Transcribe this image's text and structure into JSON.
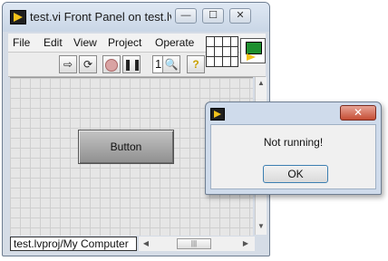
{
  "window": {
    "title": "test.vi Front Panel on test.lv...",
    "minimize_glyph": "—",
    "maximize_glyph": "☐",
    "close_glyph": "✕"
  },
  "menu": [
    "File",
    "Edit",
    "View",
    "Project",
    "Operate"
  ],
  "toolbar": {
    "run_icon": "run-arrow-icon",
    "run_continuous_icon": "run-continuously-icon",
    "abort_icon": "abort-icon",
    "pause_icon": "pause-icon",
    "font_size_text": "1",
    "search_icon": "search-icon",
    "help_icon": "help-icon"
  },
  "panel": {
    "button_label": "Button"
  },
  "status": {
    "target": "test.lvproj/My Computer"
  },
  "scrollbar": {
    "up": "▲",
    "down": "▼",
    "left": "◀",
    "right": "▶",
    "thumb_grip": "|||"
  },
  "dialog": {
    "message": "Not running!",
    "ok_label": "OK",
    "close_glyph": "✕"
  },
  "colors": {
    "labview_yellow": "#f2c21b",
    "dialog_close_red": "#c54d34",
    "ok_focus_border": "#3c7fb1"
  }
}
